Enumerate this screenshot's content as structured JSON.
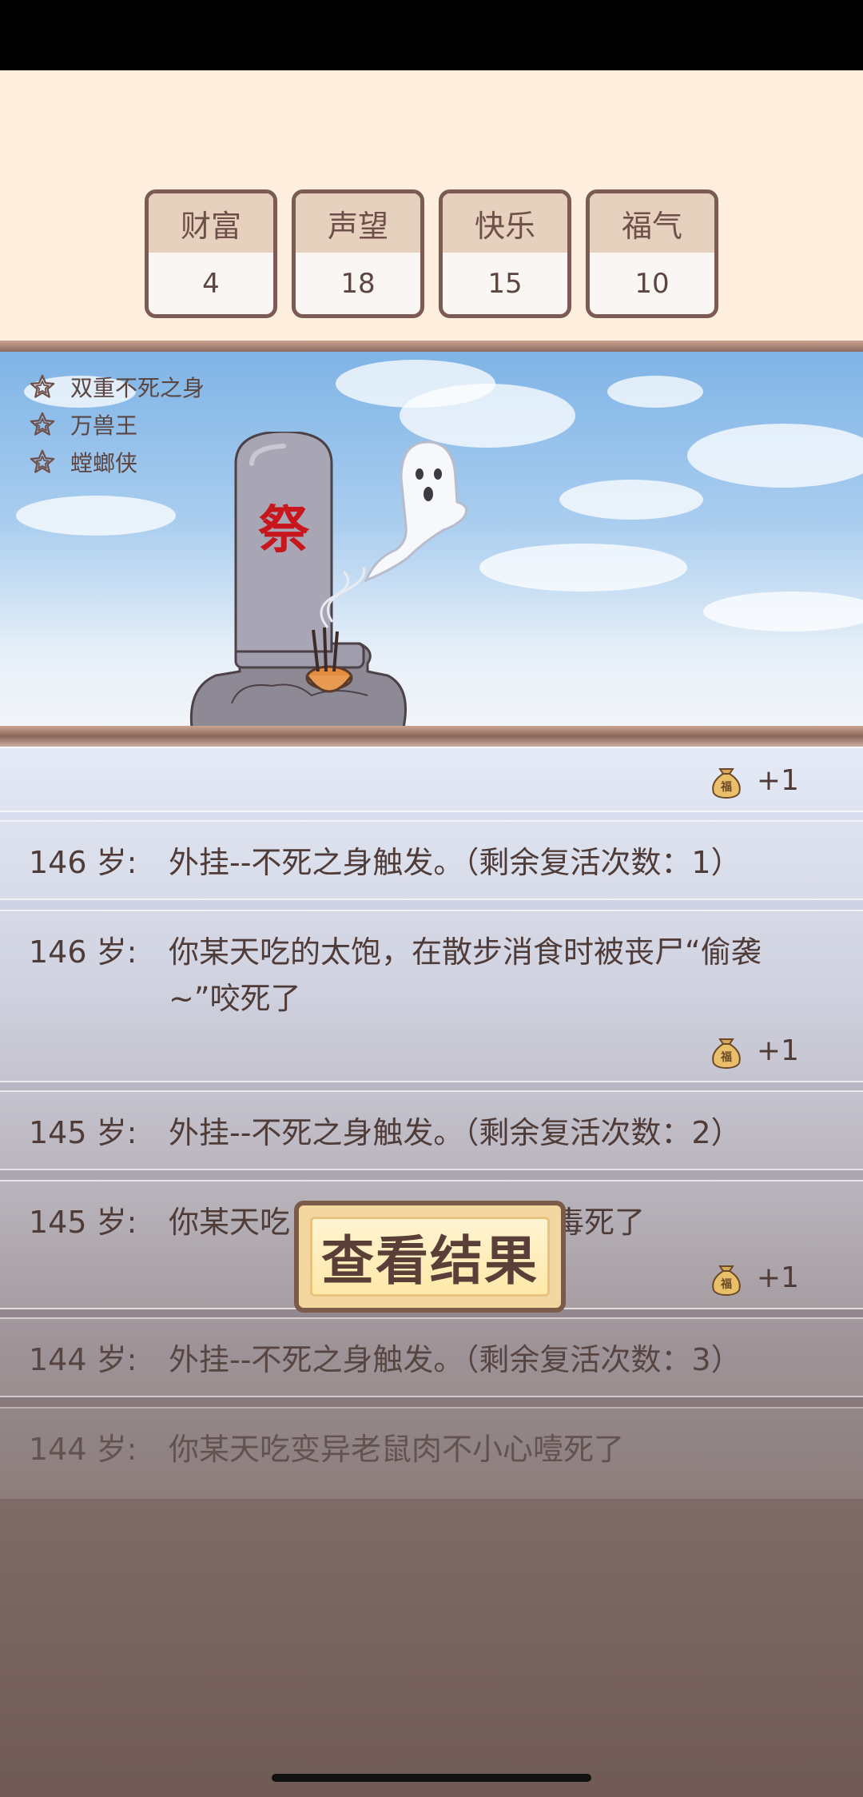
{
  "stats": [
    {
      "label": "财富",
      "value": "4"
    },
    {
      "label": "声望",
      "value": "18"
    },
    {
      "label": "快乐",
      "value": "15"
    },
    {
      "label": "福气",
      "value": "10"
    }
  ],
  "talents": [
    "双重不死之身",
    "万兽王",
    "螳螂侠"
  ],
  "tomb_char": "祭",
  "coin_char": "福",
  "log": [
    {
      "reward": "+1"
    },
    {
      "age": "146 岁:",
      "text": "外挂--不死之身触发。（剩余复活次数：1）"
    },
    {
      "age": "146 岁:",
      "text": "你某天吃的太饱，在散步消食时被丧尸“偷袭~”咬死了",
      "reward": "+1"
    },
    {
      "age": "145 岁:",
      "text": "外挂--不死之身触发。（剩余复活次数：2）"
    },
    {
      "age": "145 岁:",
      "text": "你某天吃",
      "text_tail": "毒死了",
      "reward": "+1"
    },
    {
      "age": "144 岁:",
      "text": "外挂--不死之身触发。（剩余复活次数：3）"
    },
    {
      "age": "144 岁:",
      "text": "你某天吃变异老鼠肉不小心噎死了"
    }
  ],
  "result_button": "查看结果",
  "colors": {
    "accent": "#7d5b55",
    "tomb_text": "#c8161d"
  }
}
